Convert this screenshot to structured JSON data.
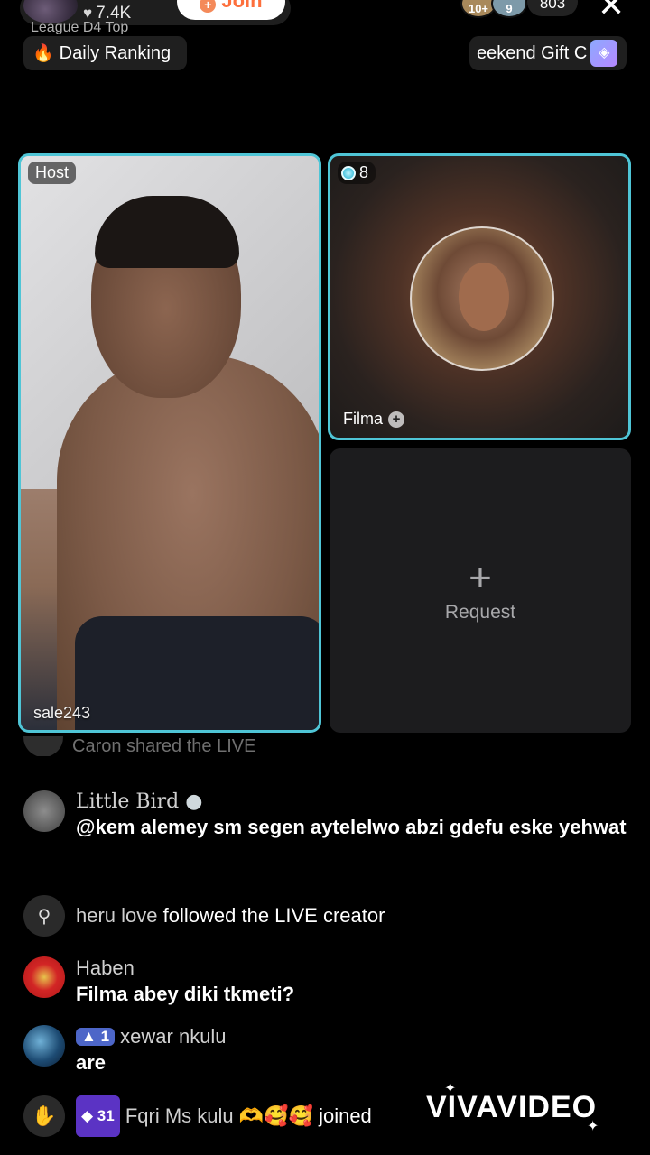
{
  "header": {
    "likes": "7.4K",
    "join_label": "Join",
    "viewer_badges": [
      "10+",
      "9"
    ],
    "viewer_count": "803",
    "league_text": "League D4 Top",
    "ranking_label": "Daily Ranking",
    "gift_label": "eekend Gift C"
  },
  "host_tile": {
    "tag": "Host",
    "username": "sale243"
  },
  "guest_tile": {
    "score": "8",
    "name": "Filma"
  },
  "request_tile": {
    "label": "Request"
  },
  "comments": {
    "faded": "Caron shared the LIVE",
    "c1": {
      "user": "Little Bird",
      "text": "@kem alemey sm segen aytelelwo abzi gdefu eske yehwat"
    },
    "c2": {
      "user": "heru love",
      "action": "followed the LIVE creator"
    },
    "c3": {
      "user": "Haben",
      "text": "Filma abey diki tkmeti?"
    },
    "c4": {
      "level": "1",
      "user": "xewar nkulu",
      "text": "are"
    },
    "c5": {
      "level": "31",
      "user": "Fqri Ms kulu",
      "emoji": "🫶🥰🥰",
      "action": "joined"
    }
  },
  "watermark": "VIVAVIDEO",
  "colors": {
    "tile_border": "#4fc5d6",
    "join_text": "#fd6f3c",
    "background": "#000000"
  }
}
